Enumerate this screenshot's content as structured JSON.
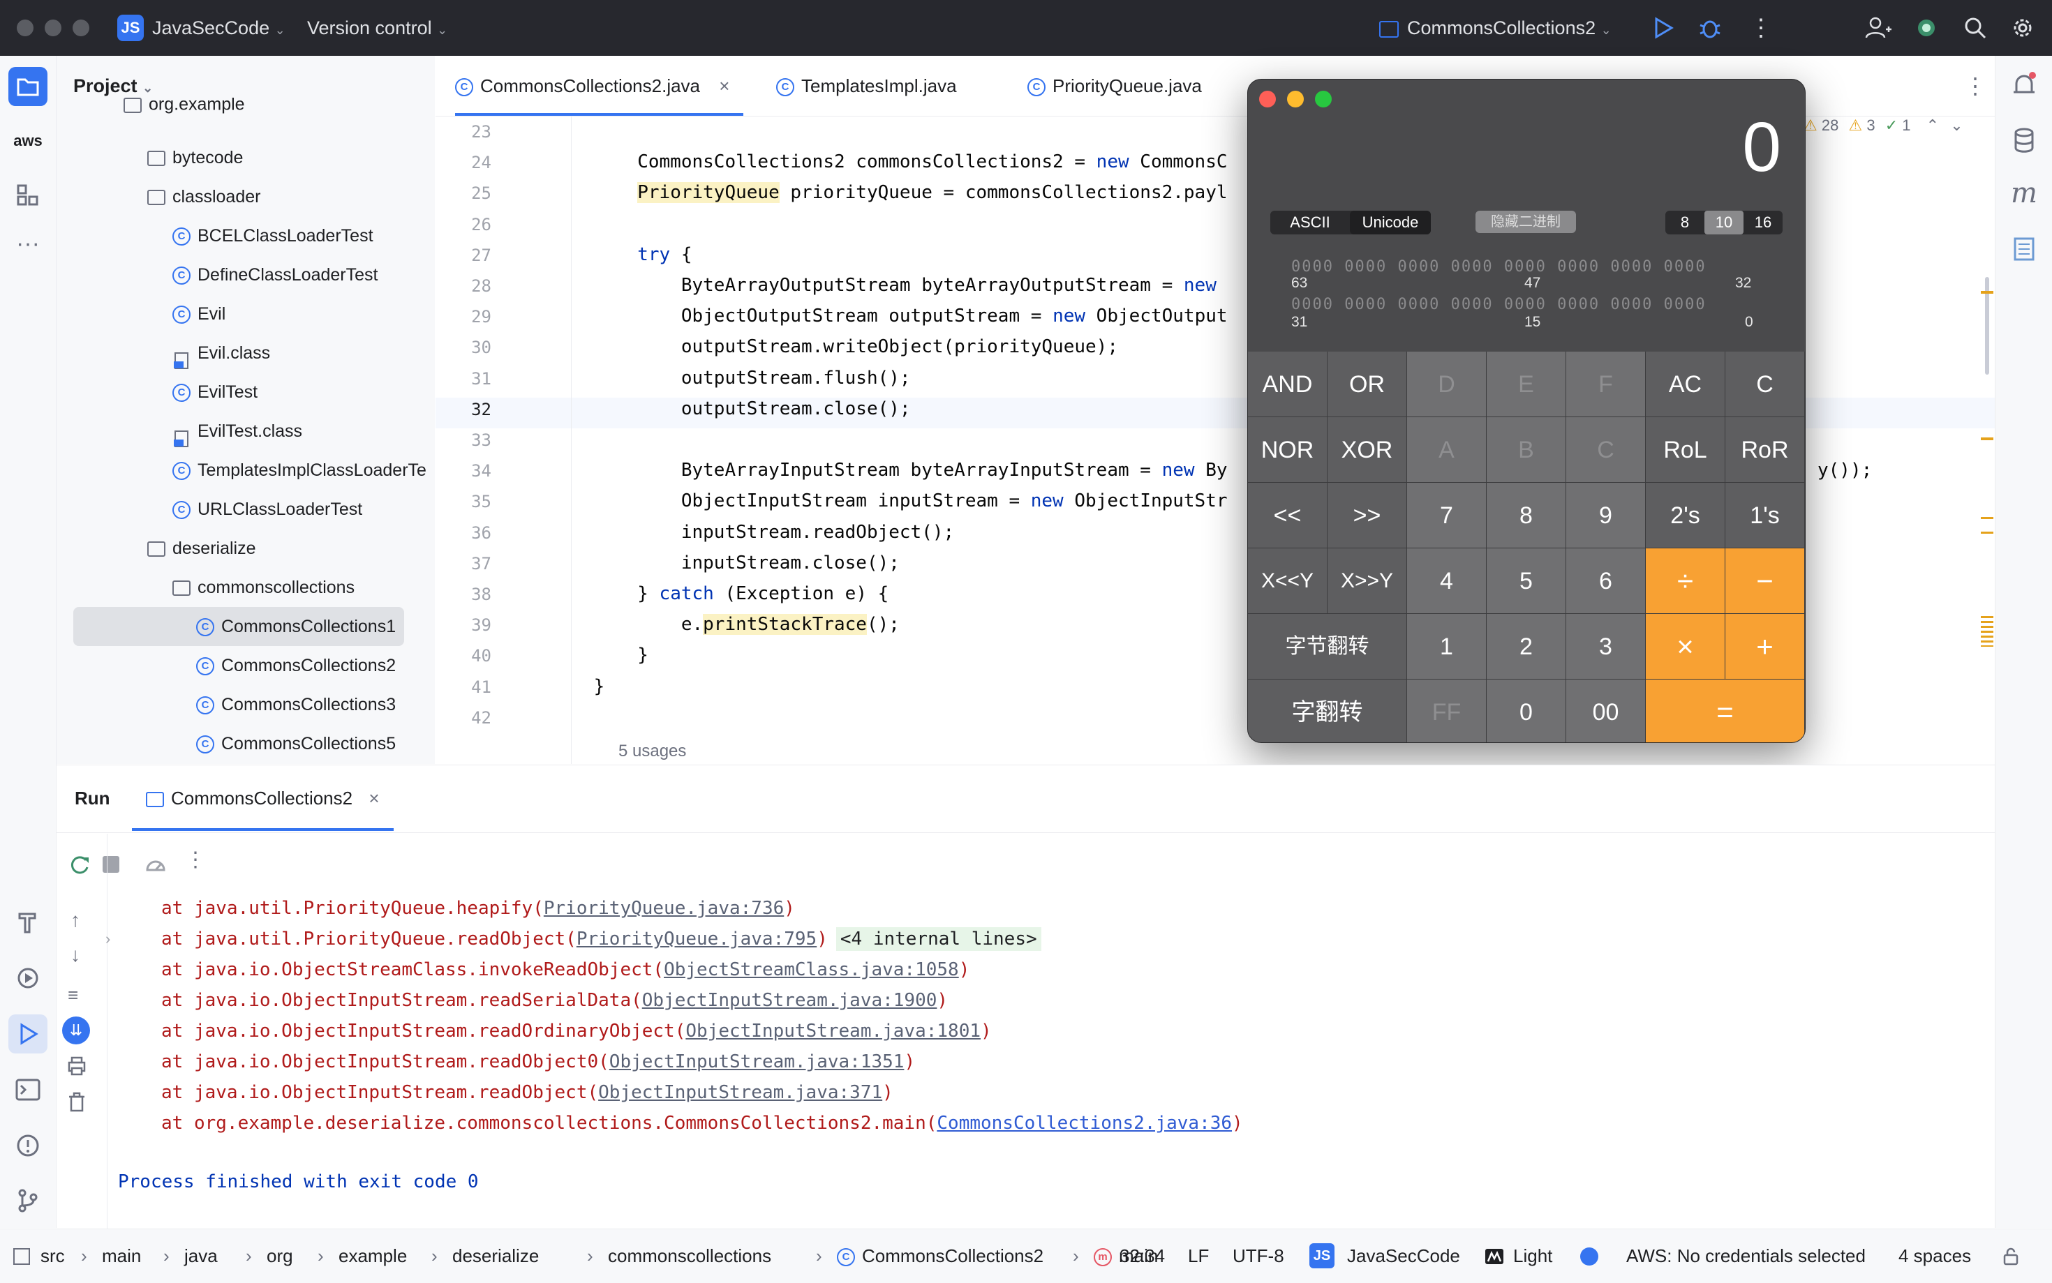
{
  "titlebar": {
    "project_badge": "JS",
    "project_name": "JavaSecCode",
    "vcs_label": "Version control",
    "run_config": "CommonsCollections2"
  },
  "project_panel": {
    "title": "Project",
    "items": [
      {
        "label": "org.example",
        "type": "folder"
      },
      {
        "label": "bytecode",
        "type": "folder"
      },
      {
        "label": "classloader",
        "type": "folder"
      },
      {
        "label": "BCELClassLoaderTest",
        "type": "class"
      },
      {
        "label": "DefineClassLoaderTest",
        "type": "class"
      },
      {
        "label": "Evil",
        "type": "class"
      },
      {
        "label": "Evil.class",
        "type": "file"
      },
      {
        "label": "EvilTest",
        "type": "class"
      },
      {
        "label": "EvilTest.class",
        "type": "file"
      },
      {
        "label": "TemplatesImplClassLoaderTe",
        "type": "class"
      },
      {
        "label": "URLClassLoaderTest",
        "type": "class"
      },
      {
        "label": "deserialize",
        "type": "folder"
      },
      {
        "label": "commonscollections",
        "type": "folder"
      },
      {
        "label": "CommonsCollections1",
        "type": "class"
      },
      {
        "label": "CommonsCollections2",
        "type": "class"
      },
      {
        "label": "CommonsCollections3",
        "type": "class"
      },
      {
        "label": "CommonsCollections5",
        "type": "class"
      }
    ]
  },
  "editor": {
    "tabs": [
      {
        "label": "CommonsCollections2.java",
        "close": "×"
      },
      {
        "label": "TemplatesImpl.java"
      },
      {
        "label": "PriorityQueue.java"
      }
    ],
    "inspections": {
      "warnings": "28",
      "weak": "3",
      "ok": "1"
    },
    "lines": [
      {
        "n": "23",
        "t": ""
      },
      {
        "n": "24",
        "t": "        CommonsCollections2 commonsCollections2 = new CommonsC"
      },
      {
        "n": "25",
        "t": "        PriorityQueue priorityQueue = commonsCollections2.payl"
      },
      {
        "n": "26",
        "t": ""
      },
      {
        "n": "27",
        "t": "        try {"
      },
      {
        "n": "28",
        "t": "            ByteArrayOutputStream byteArrayOutputStream = new "
      },
      {
        "n": "29",
        "t": "            ObjectOutputStream outputStream = new ObjectOutput"
      },
      {
        "n": "30",
        "t": "            outputStream.writeObject(priorityQueue);"
      },
      {
        "n": "31",
        "t": "            outputStream.flush();"
      },
      {
        "n": "32",
        "t": "            outputStream.close();"
      },
      {
        "n": "33",
        "t": ""
      },
      {
        "n": "34",
        "t": "            ByteArrayInputStream byteArrayInputStream = new By"
      },
      {
        "n": "35",
        "t": "            ObjectInputStream inputStream = new ObjectInputStr"
      },
      {
        "n": "36",
        "t": "            inputStream.readObject();"
      },
      {
        "n": "37",
        "t": "            inputStream.close();"
      },
      {
        "n": "38",
        "t": "        } catch (Exception e) {"
      },
      {
        "n": "39",
        "t": "            e.printStackTrace();"
      },
      {
        "n": "40",
        "t": "        }"
      },
      {
        "n": "41",
        "t": "    }"
      },
      {
        "n": "42",
        "t": ""
      }
    ],
    "line34_tail": "y());",
    "usages": "5 usages"
  },
  "calculator": {
    "display": "0",
    "mode_ascii": "ASCII",
    "mode_unicode": "Unicode",
    "hide_binary": "隐藏二进制",
    "bases": [
      "8",
      "10",
      "16"
    ],
    "bit_row1": "0000 0000 0000 0000 0000 0000 0000 0000",
    "bit_row2": "0000 0000 0000 0000 0000 0000 0000 0000",
    "bit_labels": [
      "63",
      "47",
      "32",
      "31",
      "15",
      "0"
    ],
    "keys": [
      [
        "AND",
        "OR",
        "D",
        "E",
        "F",
        "AC",
        "C"
      ],
      [
        "NOR",
        "XOR",
        "A",
        "B",
        "C",
        "RoL",
        "RoR"
      ],
      [
        "<<",
        ">>",
        "7",
        "8",
        "9",
        "2's",
        "1's"
      ],
      [
        "X<<Y",
        "X>>Y",
        "4",
        "5",
        "6",
        "÷",
        "−"
      ],
      [
        "字节翻转",
        "1",
        "2",
        "3",
        "×",
        "+"
      ],
      [
        "字翻转",
        "FF",
        "0",
        "00",
        "="
      ]
    ]
  },
  "run_panel": {
    "title": "Run",
    "tab": "CommonsCollections2",
    "tab_close": "×",
    "console": [
      {
        "pre": "at java.util.PriorityQueue.heapify(",
        "link": "PriorityQueue.java:736",
        "post": ")"
      },
      {
        "pre": "at java.util.PriorityQueue.readObject(",
        "link": "PriorityQueue.java:795",
        "post": ")",
        "extra": "<4 internal lines>"
      },
      {
        "pre": "at java.io.ObjectStreamClass.invokeReadObject(",
        "link": "ObjectStreamClass.java:1058",
        "post": ")"
      },
      {
        "pre": "at java.io.ObjectInputStream.readSerialData(",
        "link": "ObjectInputStream.java:1900",
        "post": ")"
      },
      {
        "pre": "at java.io.ObjectInputStream.readOrdinaryObject(",
        "link": "ObjectInputStream.java:1801",
        "post": ")"
      },
      {
        "pre": "at java.io.ObjectInputStream.readObject0(",
        "link": "ObjectInputStream.java:1351",
        "post": ")"
      },
      {
        "pre": "at java.io.ObjectInputStream.readObject(",
        "link": "ObjectInputStream.java:371",
        "post": ")"
      },
      {
        "pre": "at org.example.deserialize.commonscollections.CommonsCollections2.main(",
        "link": "CommonsCollections2.java:36",
        "post": ")"
      }
    ],
    "exit_message": "Process finished with exit code 0"
  },
  "statusbar": {
    "breadcrumbs": [
      "src",
      "main",
      "java",
      "org",
      "example",
      "deserialize",
      "commonscollections",
      "CommonsCollections2",
      "main"
    ],
    "position": "32:34",
    "line_sep": "LF",
    "encoding": "UTF-8",
    "project_badge": "JS",
    "project": "JavaSecCode",
    "theme": "Light",
    "aws": "AWS: No credentials selected",
    "indent": "4 spaces"
  },
  "colors": {
    "accent": "#3574f0",
    "calc_orange": "#f8a133",
    "error_text": "#b01a1a"
  }
}
